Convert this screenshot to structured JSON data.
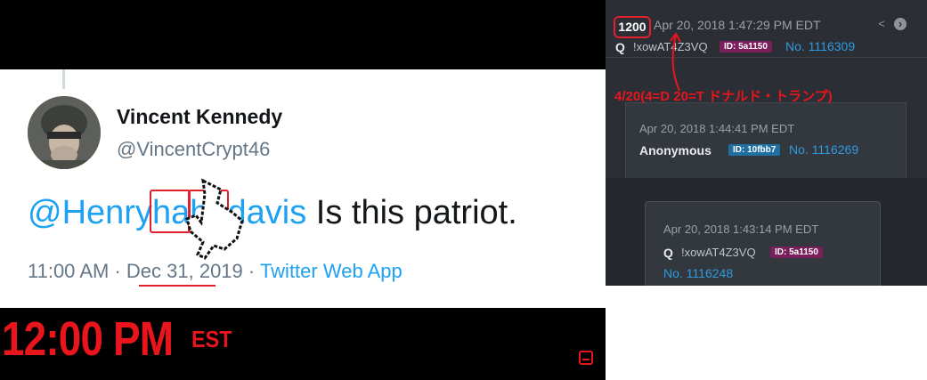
{
  "tweet": {
    "display_name": "Vincent Kennedy",
    "handle": "@VincentCrypt46",
    "mention_start": "@Henry",
    "mention_ha1": "ha",
    "mention_ha2": "ha",
    "mention_end": "davis",
    "body": " Is this patriot.",
    "time": "11:00 AM",
    "dot1": " · ",
    "date_underlined": "Dec 31,",
    "year": " 2019",
    "dot2": " · ",
    "source": "Twitter Web App"
  },
  "overlay": {
    "big_time": "12:00 PM",
    "timezone": "EST",
    "annotation": "4/20(4=D 20=T ドナルド・トランプ)"
  },
  "board": {
    "main_post": {
      "count": "1200",
      "date": "Apr 20, 2018 1:47:29 PM EDT",
      "name": "Q",
      "trip": "!xowAT4Z3VQ",
      "id": "ID: 5a1150",
      "no": "No. 1116309"
    },
    "reply1": {
      "date": "Apr 20, 2018 1:44:41 PM EDT",
      "name": "Anonymous",
      "id": "ID: 10fbb7",
      "no": "No. 1116269"
    },
    "reply2": {
      "date": "Apr 20, 2018 1:43:14 PM EDT",
      "name": "Q",
      "trip": "!xowAT4Z3VQ",
      "id": "ID: 5a1150",
      "no": "No. 1116248"
    }
  },
  "colors": {
    "red": "#e8151d",
    "link": "#1da1f2",
    "board_bg": "#2b2f35"
  }
}
